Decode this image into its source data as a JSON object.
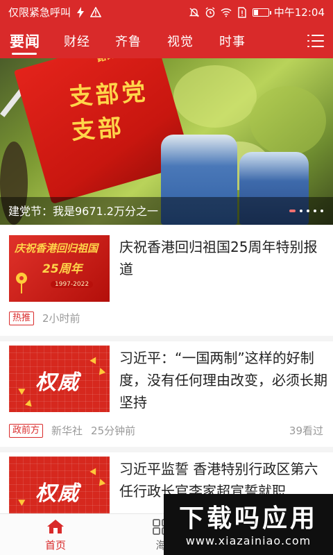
{
  "status_bar": {
    "carrier_text": "仅限紧急呼叫",
    "time": "中午12:04"
  },
  "nav": {
    "tabs": [
      {
        "label": "要闻",
        "active": true
      },
      {
        "label": "财经",
        "active": false
      },
      {
        "label": "齐鲁",
        "active": false
      },
      {
        "label": "视觉",
        "active": false
      },
      {
        "label": "时事",
        "active": false
      }
    ],
    "menu_icon": "hamburger-list-icon"
  },
  "banner": {
    "caption": "建党节：我是9671.2万分之一",
    "flag_text": "支部党支部",
    "flag_small_text": "路街道",
    "slide_count": 5,
    "active_slide": 1
  },
  "articles": [
    {
      "headline": "庆祝香港回归祖国25周年特别报道",
      "thumb_title": "庆祝香港回归祖国",
      "thumb_years": "25周年",
      "thumb_range": "1997-2022",
      "tag": "热推",
      "source": "",
      "time": "2小时前",
      "views": ""
    },
    {
      "headline": "习近平：“一国两制”这样的好制度，没有任何理由改变，必须长期坚持",
      "thumb_word": "权威",
      "tag": "政前方",
      "source": "新华社",
      "time": "25分钟前",
      "views": "39看过"
    },
    {
      "headline": "习近平监誓 香港特别行政区第六任行政长官李家超宣誓就职",
      "thumb_word": "权威"
    }
  ],
  "bottom_nav": [
    {
      "label": "首页",
      "icon": "home-icon",
      "active": true
    },
    {
      "label": "海",
      "icon": "grid-icon",
      "active": false
    }
  ],
  "watermark": {
    "main": "下载吗应用",
    "url": "www.xiazainiao.com"
  },
  "colors": {
    "brand_red": "#d92a2a",
    "text_dark": "#222222",
    "text_muted": "#999999"
  }
}
